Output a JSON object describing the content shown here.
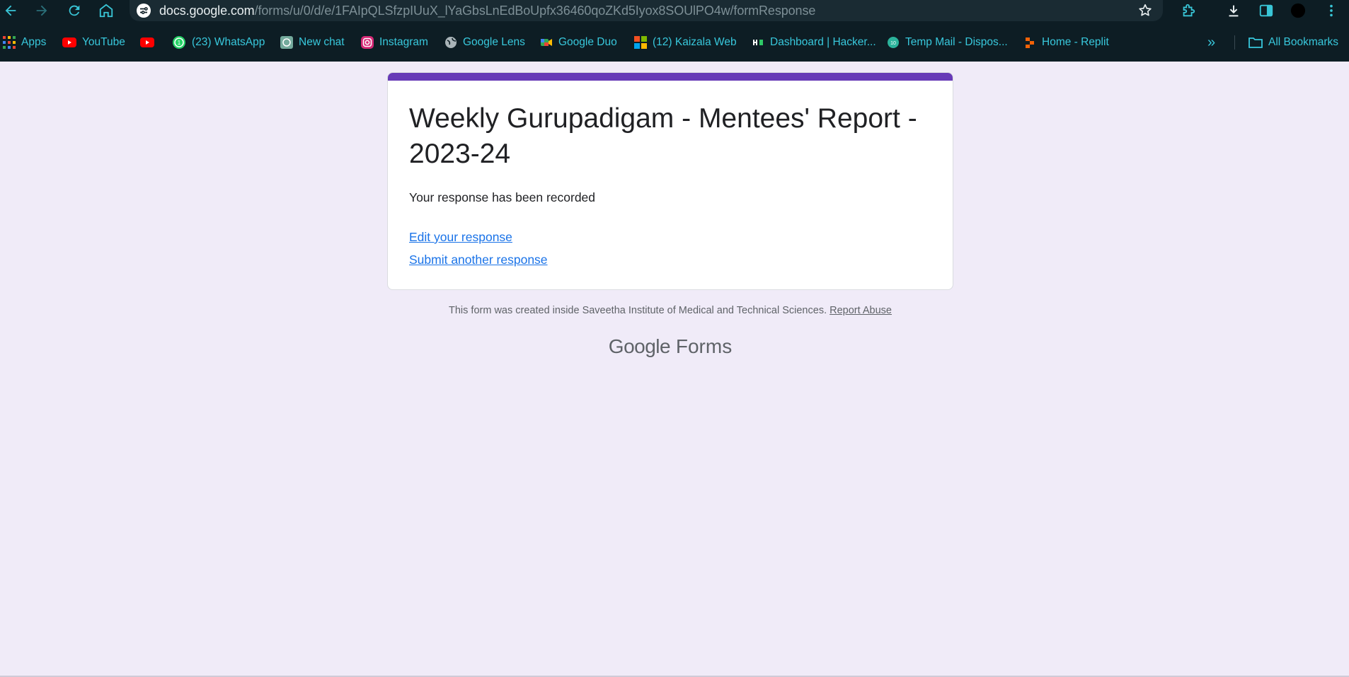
{
  "browser": {
    "url_host": "docs.google.com",
    "url_path": "/forms/u/0/d/e/1FAIpQLSfzpIUuX_lYaGbsLnEdBoUpfx36460qoZKd5Iyox8SOUlPO4w/formResponse",
    "toolbar_icons": [
      "back-icon",
      "forward-icon",
      "reload-icon",
      "home-icon",
      "site-settings-icon",
      "bookmark-star-icon",
      "extensions-icon",
      "download-icon",
      "side-panel-icon",
      "profile-avatar",
      "menu-icon"
    ],
    "accent_color": "#38c8dc"
  },
  "bookmarks": {
    "items": [
      {
        "label": "Apps",
        "icon": "apps-grid-icon"
      },
      {
        "label": "YouTube",
        "icon": "youtube-icon"
      },
      {
        "label": "",
        "icon": "youtube-icon"
      },
      {
        "label": "(23) WhatsApp",
        "icon": "whatsapp-icon"
      },
      {
        "label": "New chat",
        "icon": "chatgpt-icon"
      },
      {
        "label": "Instagram",
        "icon": "instagram-icon"
      },
      {
        "label": "Google Lens",
        "icon": "globe-icon"
      },
      {
        "label": "Google Duo",
        "icon": "google-duo-icon"
      },
      {
        "label": "(12) Kaizala Web",
        "icon": "microsoft-icon"
      },
      {
        "label": "Dashboard | Hacker...",
        "icon": "hackerrank-icon"
      },
      {
        "label": "Temp Mail - Dispos...",
        "icon": "temp-mail-icon"
      },
      {
        "label": "Home - Replit",
        "icon": "replit-icon"
      }
    ],
    "overflow_label": "»",
    "all_bookmarks_label": "All Bookmarks"
  },
  "form": {
    "title": "Weekly Gurupadigam - Mentees' Report - 2023-24",
    "confirmation": "Your response has been recorded",
    "edit_link": "Edit your response",
    "another_link": "Submit another response",
    "accent_color": "#673ab7"
  },
  "footer": {
    "text": "This form was created inside Saveetha Institute of Medical and Technical Sciences.",
    "report_abuse": "Report Abuse",
    "brand_google": "Google",
    "brand_forms": "Forms"
  }
}
